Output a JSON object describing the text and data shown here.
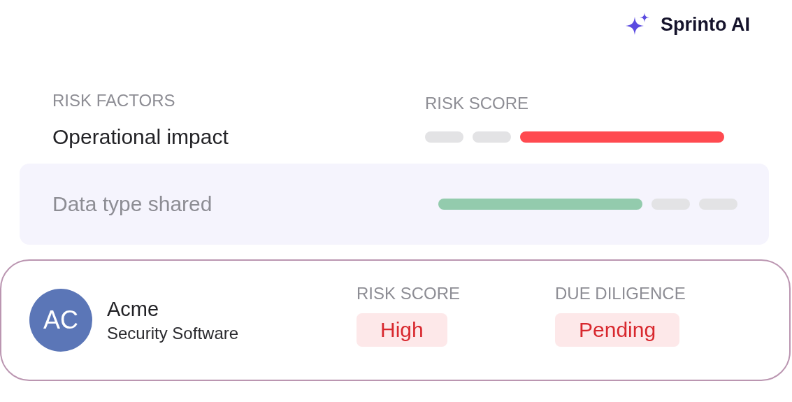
{
  "brand": {
    "name": "Sprinto AI"
  },
  "factors": {
    "heading": "RISK FACTORS",
    "score_heading": "RISK SCORE",
    "rows": [
      {
        "label": "Operational impact",
        "selected": false,
        "segments": [
          {
            "kind": "short",
            "color": "#e3e3e5"
          },
          {
            "kind": "short",
            "color": "#e3e3e5"
          },
          {
            "kind": "long",
            "color": "#ff4a50"
          }
        ]
      },
      {
        "label": "Data type shared",
        "selected": true,
        "segments": [
          {
            "kind": "long",
            "color": "#93cbad"
          },
          {
            "kind": "short",
            "color": "#e3e3e5"
          },
          {
            "kind": "short",
            "color": "#e3e3e5"
          }
        ]
      }
    ]
  },
  "vendor": {
    "initials": "AC",
    "name": "Acme",
    "category": "Security Software",
    "fields": [
      {
        "label": "RISK SCORE",
        "value": "High"
      },
      {
        "label": "DUE DILIGENCE",
        "value": "Pending"
      }
    ]
  }
}
